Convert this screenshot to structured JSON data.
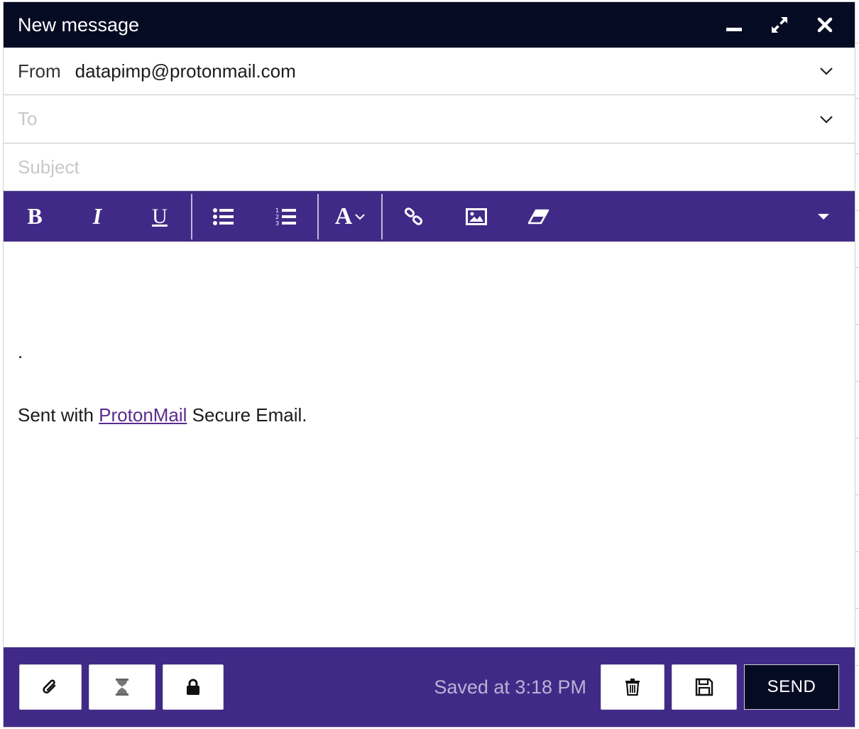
{
  "window": {
    "title": "New message"
  },
  "from": {
    "label": "From",
    "value": "datapimp@protonmail.com"
  },
  "to": {
    "placeholder": "To",
    "value": ""
  },
  "subject": {
    "placeholder": "Subject",
    "value": ""
  },
  "toolbar": {
    "bold_icon": "bold-icon",
    "italic_icon": "italic-icon",
    "underline_icon": "underline-icon",
    "font_label": "A"
  },
  "body": {
    "line1": ".",
    "signature_prefix": "Sent with ",
    "signature_link": "ProtonMail",
    "signature_suffix": " Secure Email."
  },
  "footer": {
    "saved_status": "Saved at 3:18 PM",
    "send_label": "SEND"
  },
  "colors": {
    "titlebar": "#050b23",
    "accent": "#412a87",
    "link": "#5b2b8f"
  }
}
